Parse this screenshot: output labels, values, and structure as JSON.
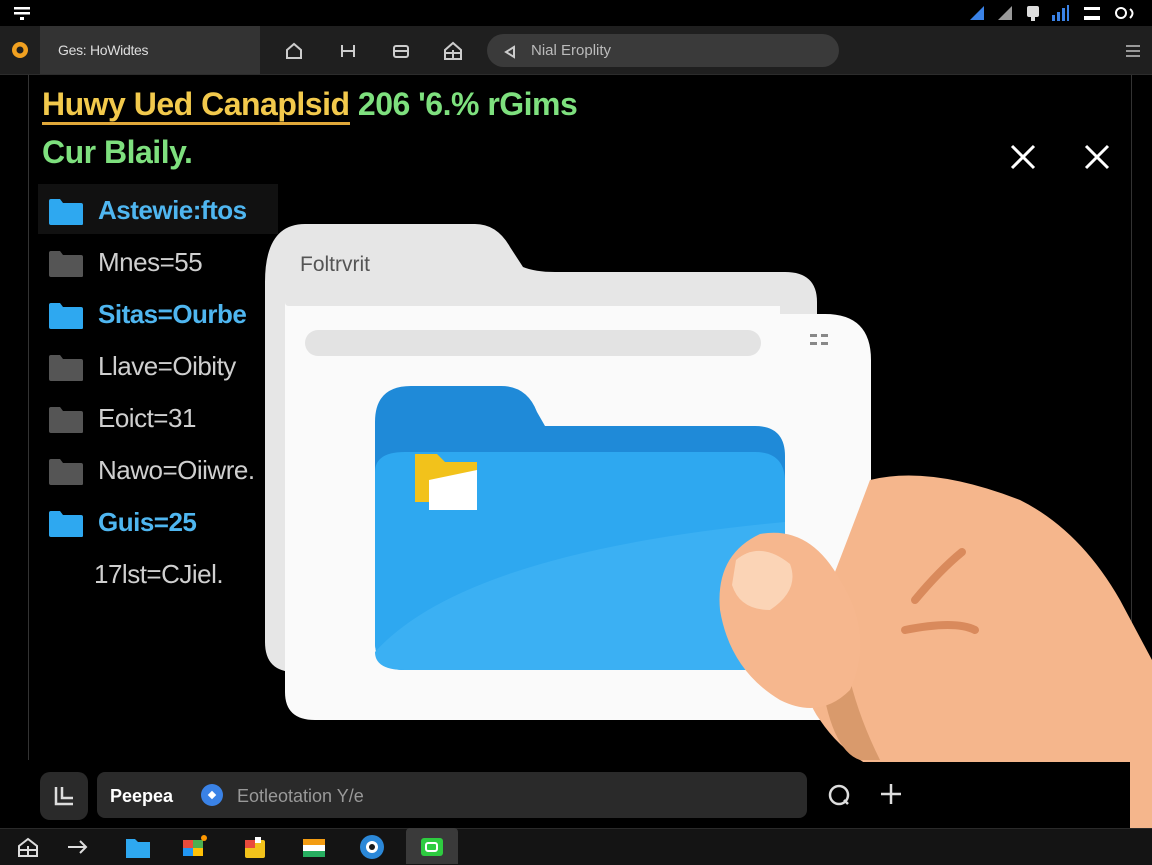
{
  "browser": {
    "tab_title": "Ges: HoWidtes",
    "address_text": "Nial Eroplity"
  },
  "page": {
    "heading_part1": "Huwy Ued Canaplsid",
    "heading_part2": "206 '6.% rGims",
    "subheading": "Cur Blaily."
  },
  "folders": [
    {
      "label": "Astewie:ftos",
      "color": "blue",
      "selected": true
    },
    {
      "label": "Mnes=55",
      "color": "gray"
    },
    {
      "label": "Sitas=Ourbe",
      "color": "blue"
    },
    {
      "label": "Llave=Oibity",
      "color": "gray"
    },
    {
      "label": "Eoict=31",
      "color": "gray"
    },
    {
      "label": "Nawo=Oiiwre.",
      "color": "gray"
    },
    {
      "label": "Guis=25",
      "color": "blue"
    },
    {
      "label": "17lst=CJiel.",
      "color": "none"
    }
  ],
  "folder_window": {
    "title": "Foltrvrit"
  },
  "bottom": {
    "input_tag": "Peepea",
    "input_placeholder": "Eotleotation Y/e"
  },
  "icons": {
    "status": [
      "wifi-icon",
      "signal-icon",
      "battery-icon",
      "clock-icon"
    ],
    "nav": [
      "home-icon",
      "bookmark-icon",
      "tabs-icon",
      "apps-icon"
    ],
    "close": "close-icon",
    "taskbar": [
      "start-icon",
      "arrow-icon",
      "files-icon",
      "photos-icon",
      "store-icon",
      "media-icon",
      "browser-icon",
      "chat-icon"
    ]
  },
  "colors": {
    "heading_yellow": "#f2c94c",
    "heading_green": "#7ee07e",
    "folder_blue": "#2ea8f0",
    "folder_gray": "#555555",
    "accent_orange": "#f0a020"
  }
}
